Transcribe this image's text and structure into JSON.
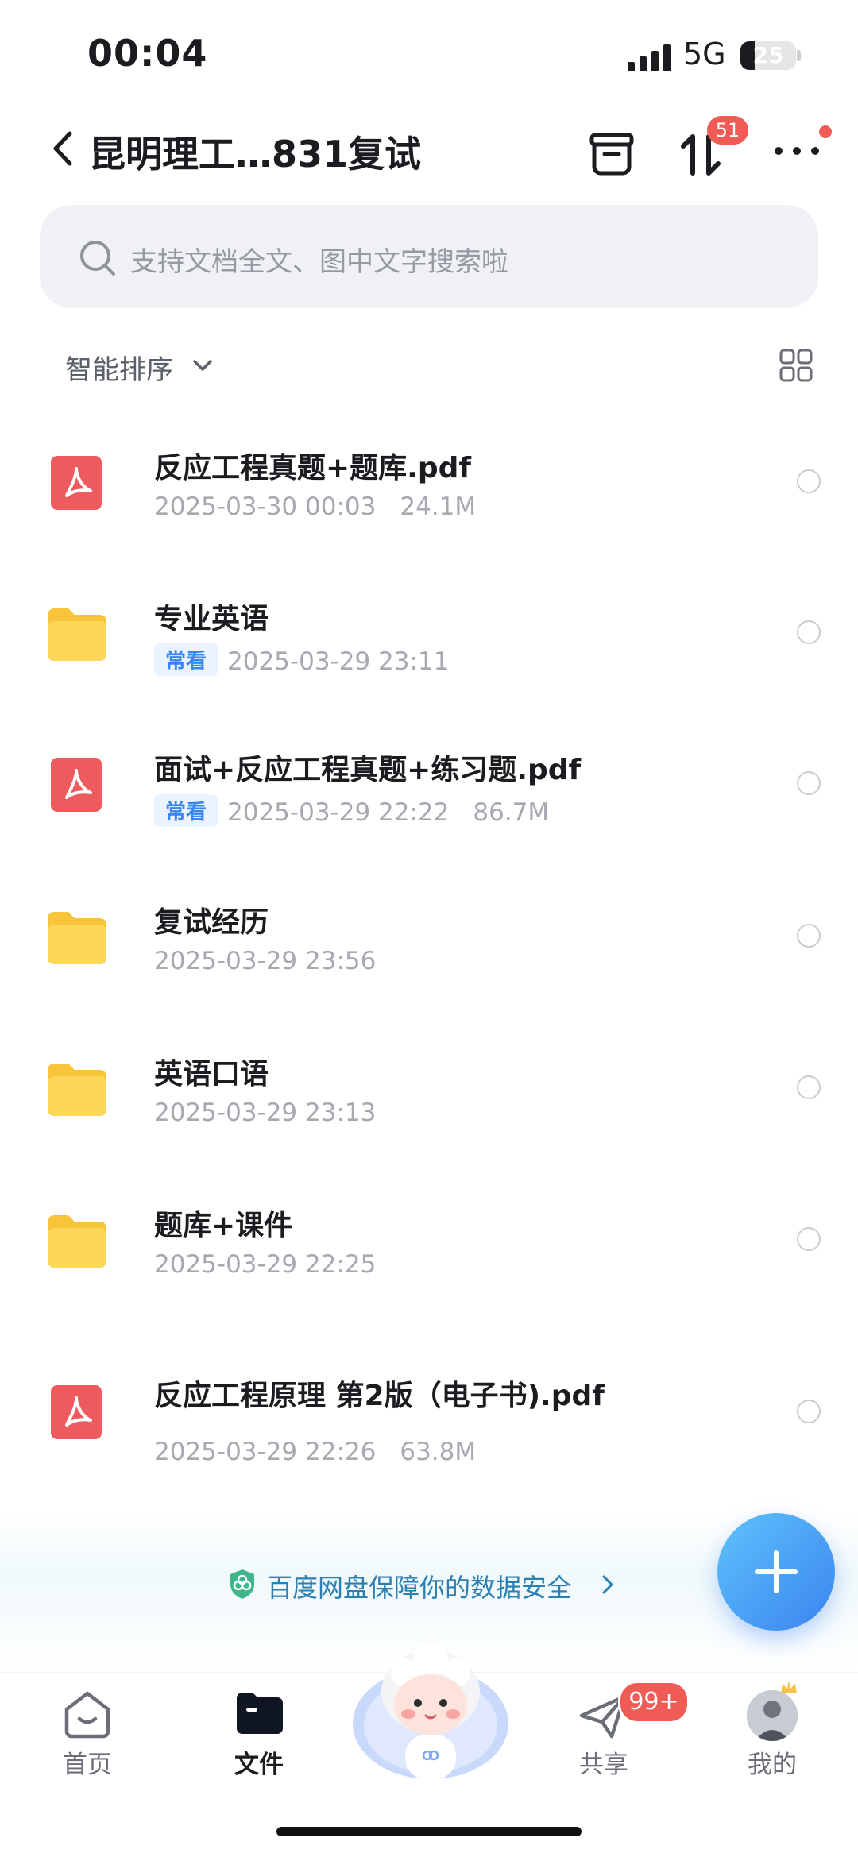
{
  "status_bar": {
    "time": "00:04",
    "network": "5G",
    "battery": "25",
    "battery_level": 0.25
  },
  "header": {
    "title": "昆明理工…831复试",
    "transfer_badge": "51"
  },
  "search": {
    "placeholder": "支持文档全文、图中文字搜索啦"
  },
  "sort": {
    "label": "智能排序"
  },
  "files": [
    {
      "name": "反应工程真题+题库.pdf",
      "type": "pdf",
      "tag": "",
      "date": "2025-03-30 00:03",
      "size": "24.1M"
    },
    {
      "name": "专业英语",
      "type": "folder",
      "tag": "常看",
      "date": "2025-03-29 23:11",
      "size": ""
    },
    {
      "name": "面试+反应工程真题+练习题.pdf",
      "type": "pdf",
      "tag": "常看",
      "date": "2025-03-29 22:22",
      "size": "86.7M"
    },
    {
      "name": "复试经历",
      "type": "folder",
      "tag": "",
      "date": "2025-03-29 23:56",
      "size": ""
    },
    {
      "name": "英语口语",
      "type": "folder",
      "tag": "",
      "date": "2025-03-29 23:13",
      "size": ""
    },
    {
      "name": "题库+课件",
      "type": "folder",
      "tag": "",
      "date": "2025-03-29 22:25",
      "size": ""
    },
    {
      "name": "反应工程原理 第2版（电子书).pdf",
      "type": "pdf",
      "tag": "",
      "date": "2025-03-29 22:26",
      "size": "63.8M"
    }
  ],
  "security_banner": {
    "text": "百度网盘保障你的数据安全"
  },
  "tabbar": {
    "home": "首页",
    "files": "文件",
    "share": "共享",
    "share_badge": "99+",
    "me": "我的"
  },
  "colors": {
    "accent": "#3a84f0",
    "badge": "#f15b56",
    "pdf": "#ee5b5e",
    "folder": "#fbd046"
  }
}
